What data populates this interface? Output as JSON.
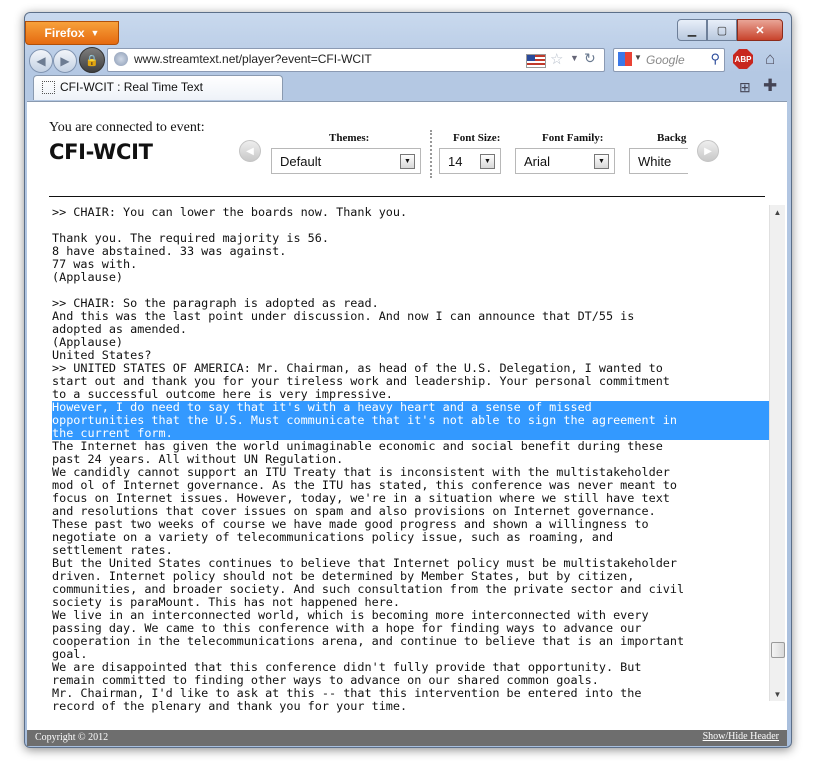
{
  "browser": {
    "app_button": "Firefox",
    "url": "www.streamtext.net/player?event=CFI-WCIT",
    "search_placeholder": "Google",
    "abp_label": "ABP",
    "tab_title": "CFI-WCIT : Real Time Text"
  },
  "header": {
    "connected_label": "You are connected to event:",
    "event_name": "CFI-WCIT",
    "themes": {
      "label": "Themes:",
      "value": "Default"
    },
    "font_size": {
      "label": "Font Size:",
      "value": "14"
    },
    "font_family": {
      "label": "Font Family:",
      "value": "Arial"
    },
    "background": {
      "label": "Backg",
      "value": "White"
    }
  },
  "transcript_lines": [
    {
      "text": ">> CHAIR: You can lower the boards now. Thank you.",
      "highlight": false
    },
    {
      "text": "",
      "highlight": false
    },
    {
      "text": "Thank you. The required majority is 56.",
      "highlight": false
    },
    {
      "text": "8 have abstained. 33 was against.",
      "highlight": false
    },
    {
      "text": "77 was with.",
      "highlight": false
    },
    {
      "text": "(Applause)",
      "highlight": false
    },
    {
      "text": "",
      "highlight": false
    },
    {
      "text": ">> CHAIR: So the paragraph is adopted as read.",
      "highlight": false
    },
    {
      "text": "And this was the last point under discussion. And now I can announce that DT/55 is",
      "highlight": false
    },
    {
      "text": "adopted as amended.",
      "highlight": false
    },
    {
      "text": "(Applause)",
      "highlight": false
    },
    {
      "text": "United States?",
      "highlight": false
    },
    {
      "text": ">> UNITED STATES OF AMERICA: Mr. Chairman, as head of the U.S. Delegation, I wanted to",
      "highlight": false
    },
    {
      "text": "start out and thank you for your tireless work and leadership. Your personal commitment",
      "highlight": false
    },
    {
      "text": "to a successful outcome here is very impressive.",
      "highlight": false
    },
    {
      "text": "However, I do need to say that it's with a heavy heart and a sense of missed",
      "highlight": true
    },
    {
      "text": "opportunities that the U.S. Must communicate that it's not able to sign the agreement in",
      "highlight": true
    },
    {
      "text": "the current form.",
      "highlight": true
    },
    {
      "text": "The Internet has given the world unimaginable economic and social benefit during these",
      "highlight": false
    },
    {
      "text": "past 24 years. All without UN Regulation.",
      "highlight": false
    },
    {
      "text": "We candidly cannot support an ITU Treaty that is inconsistent with the multistakeholder",
      "highlight": false
    },
    {
      "text": "mod ol of Internet governance. As the ITU has stated, this conference was never meant to",
      "highlight": false
    },
    {
      "text": "focus on Internet issues. However, today, we're in a situation where we still have text",
      "highlight": false
    },
    {
      "text": "and resolutions that cover issues on spam and also provisions on Internet governance.",
      "highlight": false
    },
    {
      "text": "These past two weeks of course we have made good progress and shown a willingness to",
      "highlight": false
    },
    {
      "text": "negotiate on a variety of telecommunications policy issue, such as roaming, and",
      "highlight": false
    },
    {
      "text": "settlement rates.",
      "highlight": false
    },
    {
      "text": "But the United States continues to believe that Internet policy must be multistakeholder",
      "highlight": false
    },
    {
      "text": "driven. Internet policy should not be determined by Member States, but by citizen,",
      "highlight": false
    },
    {
      "text": "communities, and broader society. And such consultation from the private sector and civil",
      "highlight": false
    },
    {
      "text": "society is paraMount. This has not happened here.",
      "highlight": false
    },
    {
      "text": "We live in an interconnected world, which is becoming more interconnected with every",
      "highlight": false
    },
    {
      "text": "passing day. We came to this conference with a hope for finding ways to advance our",
      "highlight": false
    },
    {
      "text": "cooperation in the telecommunications arena, and continue to believe that is an important",
      "highlight": false
    },
    {
      "text": "goal.",
      "highlight": false
    },
    {
      "text": "We are disappointed that this conference didn't fully provide that opportunity. But",
      "highlight": false
    },
    {
      "text": "remain committed to finding other ways to advance on our shared common goals.",
      "highlight": false
    },
    {
      "text": "Mr. Chairman, I'd like to ask at this -- that this intervention be entered into the",
      "highlight": false
    },
    {
      "text": "record of the plenary and thank you for your time.",
      "highlight": false
    }
  ],
  "transcript_scroll_position": 0.94,
  "footer": {
    "copyright": "Copyright © 2012",
    "toggle_header": "Show/Hide Header"
  },
  "colors": {
    "selection": "#3399ff",
    "firefox_button": "#e56a10",
    "footer_bar": "#6e6e6e"
  }
}
